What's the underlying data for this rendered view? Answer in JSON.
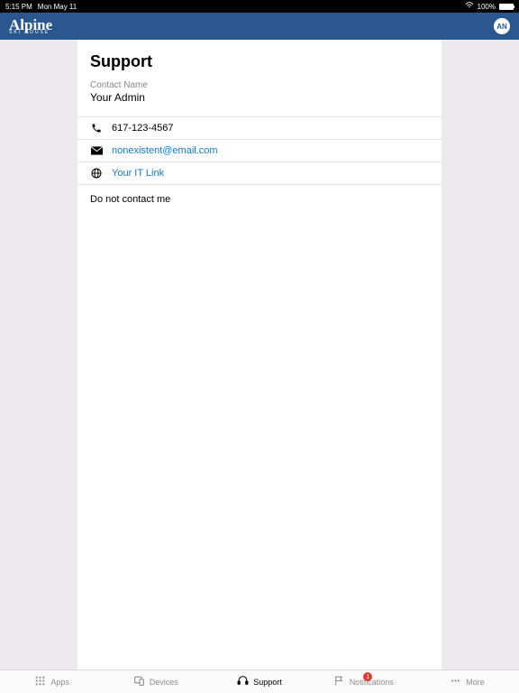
{
  "status": {
    "time": "5:15 PM",
    "date": "Mon May 11",
    "battery": "100%"
  },
  "header": {
    "brand_main": "Alpine",
    "brand_sub": "SKI HOUSE",
    "avatar": "AN"
  },
  "page": {
    "title": "Support",
    "contact_label": "Contact Name",
    "contact_name": "Your Admin",
    "phone": "617-123-4567",
    "email": "nonexistent@email.com",
    "link": "Your IT Link",
    "note": "Do not contact me"
  },
  "tabs": {
    "apps": "Apps",
    "devices": "Devices",
    "support": "Support",
    "notifications": "Notifications",
    "more": "More",
    "badge": "1"
  }
}
